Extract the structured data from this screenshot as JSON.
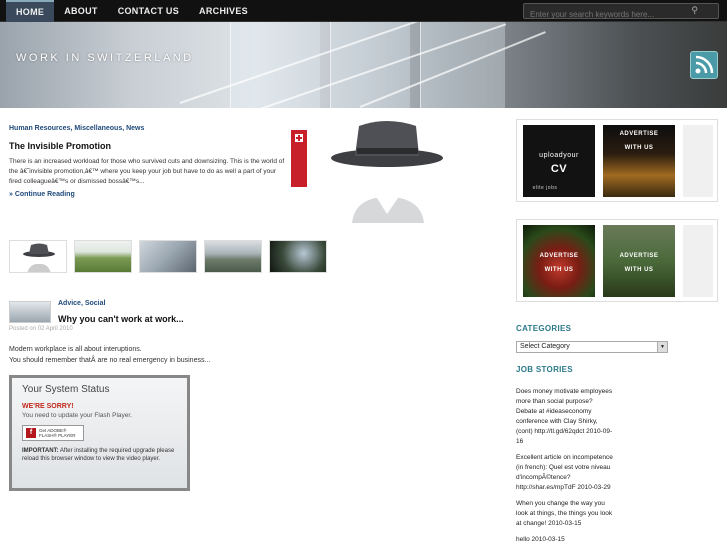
{
  "nav": {
    "items": [
      {
        "label": "HOME",
        "active": true
      },
      {
        "label": "ABOUT",
        "active": false
      },
      {
        "label": "CONTACT US",
        "active": false
      },
      {
        "label": "ARCHIVES",
        "active": false
      }
    ],
    "search_placeholder": "Enter your search keywords here..."
  },
  "banner": {
    "title": "WORK IN SWITZERLAND",
    "rss_icon": "rss-icon"
  },
  "featured": {
    "categories": "Human Resources, Miscellaneous, News",
    "title": "The Invisible Promotion",
    "excerpt": "There is an increased workload for those who survived cuts and downsizing. This is the world of the â€˜invisible promotion,â€™ where you keep your job but have to do as well a part of your fired colleagueâ€™s or dismissed bossâ€™s...",
    "more": "Continue Reading"
  },
  "post2": {
    "categories": "Advice, Social",
    "title": "Why you can't work at work...",
    "date": "Posted on 02 April 2010",
    "excerpt_line1": "Modern workplace is all about interuptions.",
    "excerpt_line2": "You should remember thatÂ are no real emergency in business..."
  },
  "flash": {
    "heading": "Your System Status",
    "sorry": "WE'RE SORRY!",
    "need": "You need to update your Flash Player.",
    "badge_line1": "Get ADOBE®",
    "badge_line2": "FLASH® PLAYER",
    "important_label": "IMPORTANT:",
    "important_text": "After installing the required upgrade please reload this browser window to view the video player."
  },
  "ads": {
    "ad1_top": "uploadyour",
    "ad1_mid": "CV",
    "ad1_bottom": "elite jobs",
    "ad2_line1": "ADVERTISE",
    "ad2_line2": "WITH US",
    "ad3_line1": "ADVERTISE",
    "ad3_line2": "WITH US",
    "ad4_line1": "ADVERTISE",
    "ad4_line2": "WITH US"
  },
  "sidebar": {
    "categories_heading": "CATEGORIES",
    "select_value": "Select Category",
    "stories_heading": "JOB STORIES",
    "stories": [
      "Does money motivate employees more than social purpose? Debate at #ideaseconomy conference with Clay Shirky, (cont) http://tl.gd/62qdct 2010-09-16",
      "Excellent article on incompetence (in french): Quel est votre niveau d'incompÃ©tence? http://shar.es/mpTdF 2010-03-29",
      "When you change the way you look at things, the things you look at change! 2010-03-15",
      "hello 2010-03-15"
    ]
  },
  "colors": {
    "nav_bg": "#111111",
    "link": "#1f4a7a",
    "sidebar_heading": "#2c7a8a",
    "alert": "#c0281c"
  }
}
